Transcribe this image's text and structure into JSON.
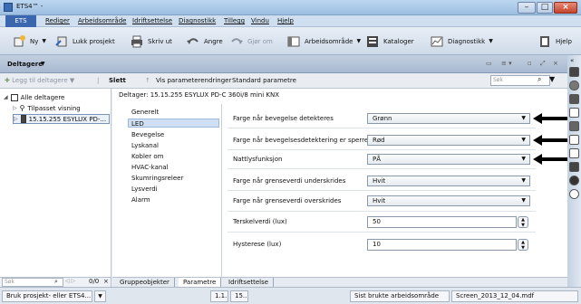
{
  "window": {
    "title": "ETS4™ -"
  },
  "menubar": {
    "ets": "ETS",
    "items": [
      "Rediger",
      "Arbeidsområde",
      "Idriftsettelse",
      "Diagnostikk",
      "Tillegg",
      "Vindu",
      "Hjelp"
    ]
  },
  "toolbar": {
    "new": "Ny",
    "close_project": "Lukk prosjekt",
    "print": "Skriv ut",
    "undo": "Angre",
    "redo": "Gjør om",
    "workspace": "Arbeidsområde",
    "catalogs": "Kataloger",
    "diagnostics": "Diagnostikk",
    "help": "Hjelp"
  },
  "panel": {
    "title": "Deltagere",
    "add_participants": "Legg til deltagere",
    "delete": "Slett",
    "show_changes": "Vis parameterendringer",
    "standard_params": "Standard parametre",
    "search_placeholder": "Søk"
  },
  "tree": {
    "root": "Alle deltagere",
    "items": [
      "Tilpasset visning",
      "15.15.255  ESYLUX PD-..."
    ],
    "search_placeholder": "Søk",
    "count": "0/0"
  },
  "device": {
    "header": "Deltager: 15.15.255  ESYLUX PD-C 360i/8 mini KNX"
  },
  "nav": {
    "items": [
      "Generelt",
      "LED",
      "Bevegelse",
      "Lyskanal",
      "Kobler om",
      "HVAC-kanal",
      "Skumringsreleer",
      "Lysverdi",
      "Alarm"
    ],
    "selected": "LED"
  },
  "params": [
    {
      "label": "Farge når bevegelse detekteres",
      "value": "Grønn",
      "kind": "select"
    },
    {
      "label": "Farge når bevegelsesdetektering er sperret",
      "value": "Rød",
      "kind": "select"
    },
    {
      "label": "Nattlysfunksjon",
      "value": "PÅ",
      "kind": "select"
    },
    {
      "label": "Farge når grenseverdi underskrides",
      "value": "Hvit",
      "kind": "select"
    },
    {
      "label": "Farge når grenseverdi overskrides",
      "value": "Hvit",
      "kind": "select"
    },
    {
      "label": "Terskelverdi (lux)",
      "value": "50",
      "kind": "number"
    },
    {
      "label": "Hysterese (lux)",
      "value": "10",
      "kind": "number"
    }
  ],
  "tabs": [
    "Gruppeobjekter",
    "Parametre",
    "Idriftsettelse"
  ],
  "status": {
    "recent_project": "Bruk prosjekt- eller ETS4...",
    "s2": "1.1...",
    "s3": "15...",
    "workspace": "Sist brukte arbeidsområde",
    "file": "Screen_2013_12_04.mdf"
  },
  "colors": {
    "accent": "#3a67ad",
    "selected": "#cfe0f3"
  }
}
